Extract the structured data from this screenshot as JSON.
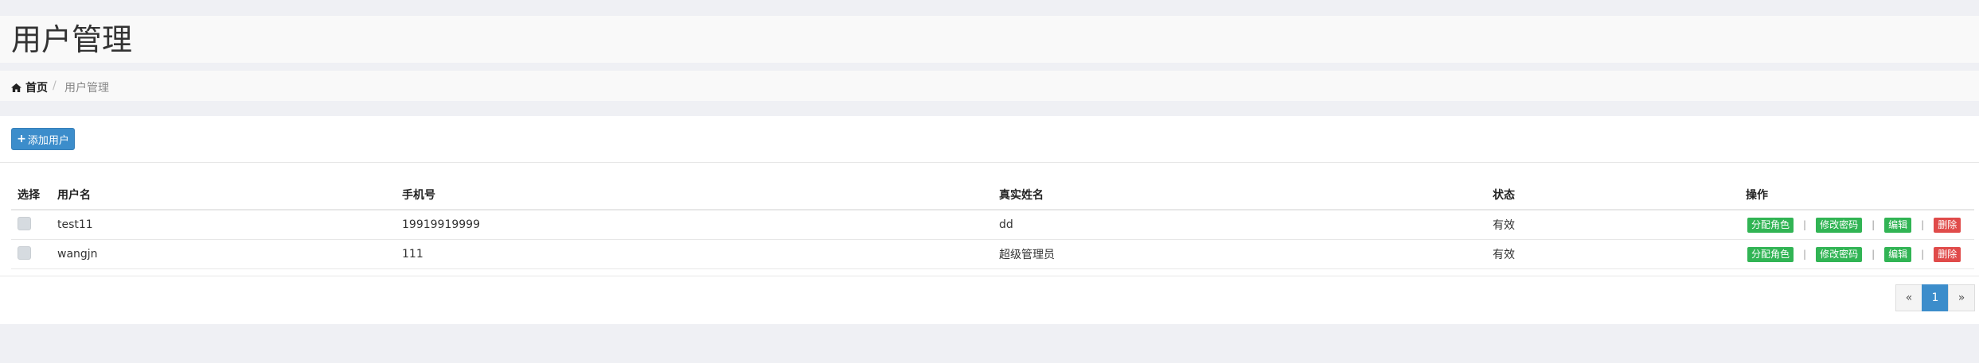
{
  "header": {
    "title": "用户管理"
  },
  "breadcrumb": {
    "home": "首页",
    "separator": "/",
    "current": "用户管理"
  },
  "toolbar": {
    "add_label": "添加用户"
  },
  "table": {
    "columns": [
      "选择",
      "用户名",
      "手机号",
      "真实姓名",
      "状态",
      "操作"
    ],
    "rows": [
      {
        "username": "test11",
        "phone": "19919919999",
        "realname": "dd",
        "status": "有效"
      },
      {
        "username": "wangjn",
        "phone": "111",
        "realname": "超级管理员",
        "status": "有效"
      }
    ],
    "actions": {
      "assign_role": "分配角色",
      "change_password": "修改密码",
      "edit": "编辑",
      "delete": "删除",
      "divider": "|"
    }
  },
  "pagination": {
    "prev": "«",
    "page": "1",
    "next": "»"
  },
  "colors": {
    "primary": "#3c8dcb",
    "success": "#31b454",
    "danger": "#e04b4a",
    "background": "#eff0f4"
  }
}
